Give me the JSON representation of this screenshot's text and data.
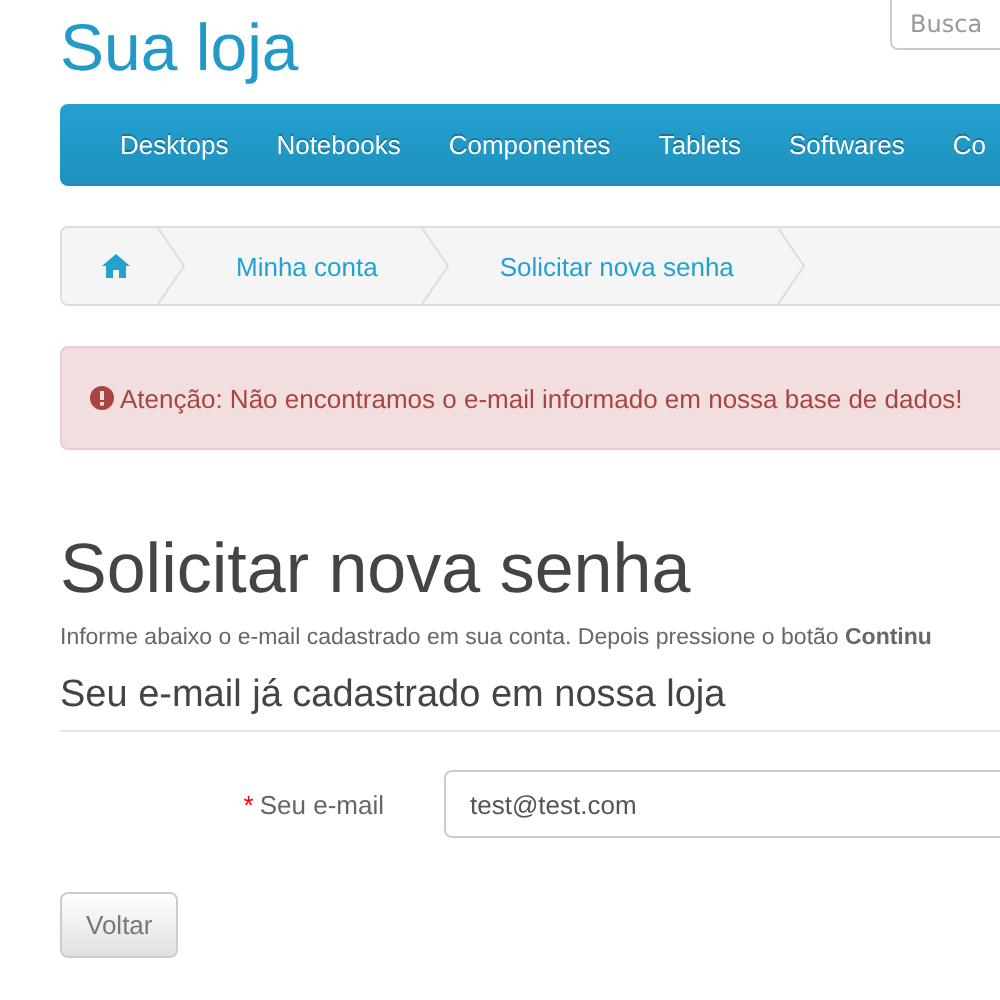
{
  "header": {
    "logo": "Sua loja",
    "search": {
      "placeholder": "Busca"
    }
  },
  "menu": [
    "Desktops",
    "Notebooks",
    "Componentes",
    "Tablets",
    "Softwares",
    "Co"
  ],
  "breadcrumb": [
    {
      "kind": "home"
    },
    {
      "kind": "link",
      "label": "Minha conta"
    },
    {
      "kind": "link",
      "label": "Solicitar nova senha"
    }
  ],
  "alert": {
    "text": "Atenção: Não encontramos o e-mail informado em nossa base de dados!"
  },
  "title": "Solicitar nova senha",
  "intro": "Informe abaixo o e-mail cadastrado em sua conta. Depois pressione o botão **Continu**",
  "fieldset": {
    "legend": "Seu e-mail já cadastrado em nossa loja",
    "fields": [
      {
        "label": "Seu e-mail",
        "required": true,
        "required_mark": "*",
        "value": "test@test.com"
      }
    ]
  },
  "buttons": [
    "Voltar"
  ]
}
